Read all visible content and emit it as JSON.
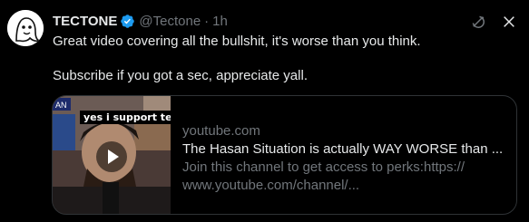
{
  "tweet": {
    "author": {
      "display_name": "TECTONE",
      "handle": "@Tectone",
      "verified": true,
      "avatar_icon": "ghost-avatar-icon"
    },
    "separator": "·",
    "time": "1h",
    "text_line1": "Great video covering all the bullshit, it's worse than you think.",
    "text_line2": "Subscribe if you got a sec, appreciate yall.",
    "card": {
      "thumbnail_caption": "yes i support ter",
      "domain": "youtube.com",
      "title": "The Hasan Situation is actually WAY WORSE than ...",
      "description_line1": "Join this channel to get access to perks:https://",
      "description_line2": "www.youtube.com/channel/..."
    },
    "icons": {
      "grok": "grok-icon",
      "close": "close-icon",
      "verified": "verified-badge-icon",
      "play": "play-icon"
    }
  },
  "colors": {
    "background": "#000000",
    "primary_text": "#e7e9ea",
    "secondary_text": "#71767b",
    "border": "#2f3336",
    "verified_blue": "#1d9bf0"
  }
}
